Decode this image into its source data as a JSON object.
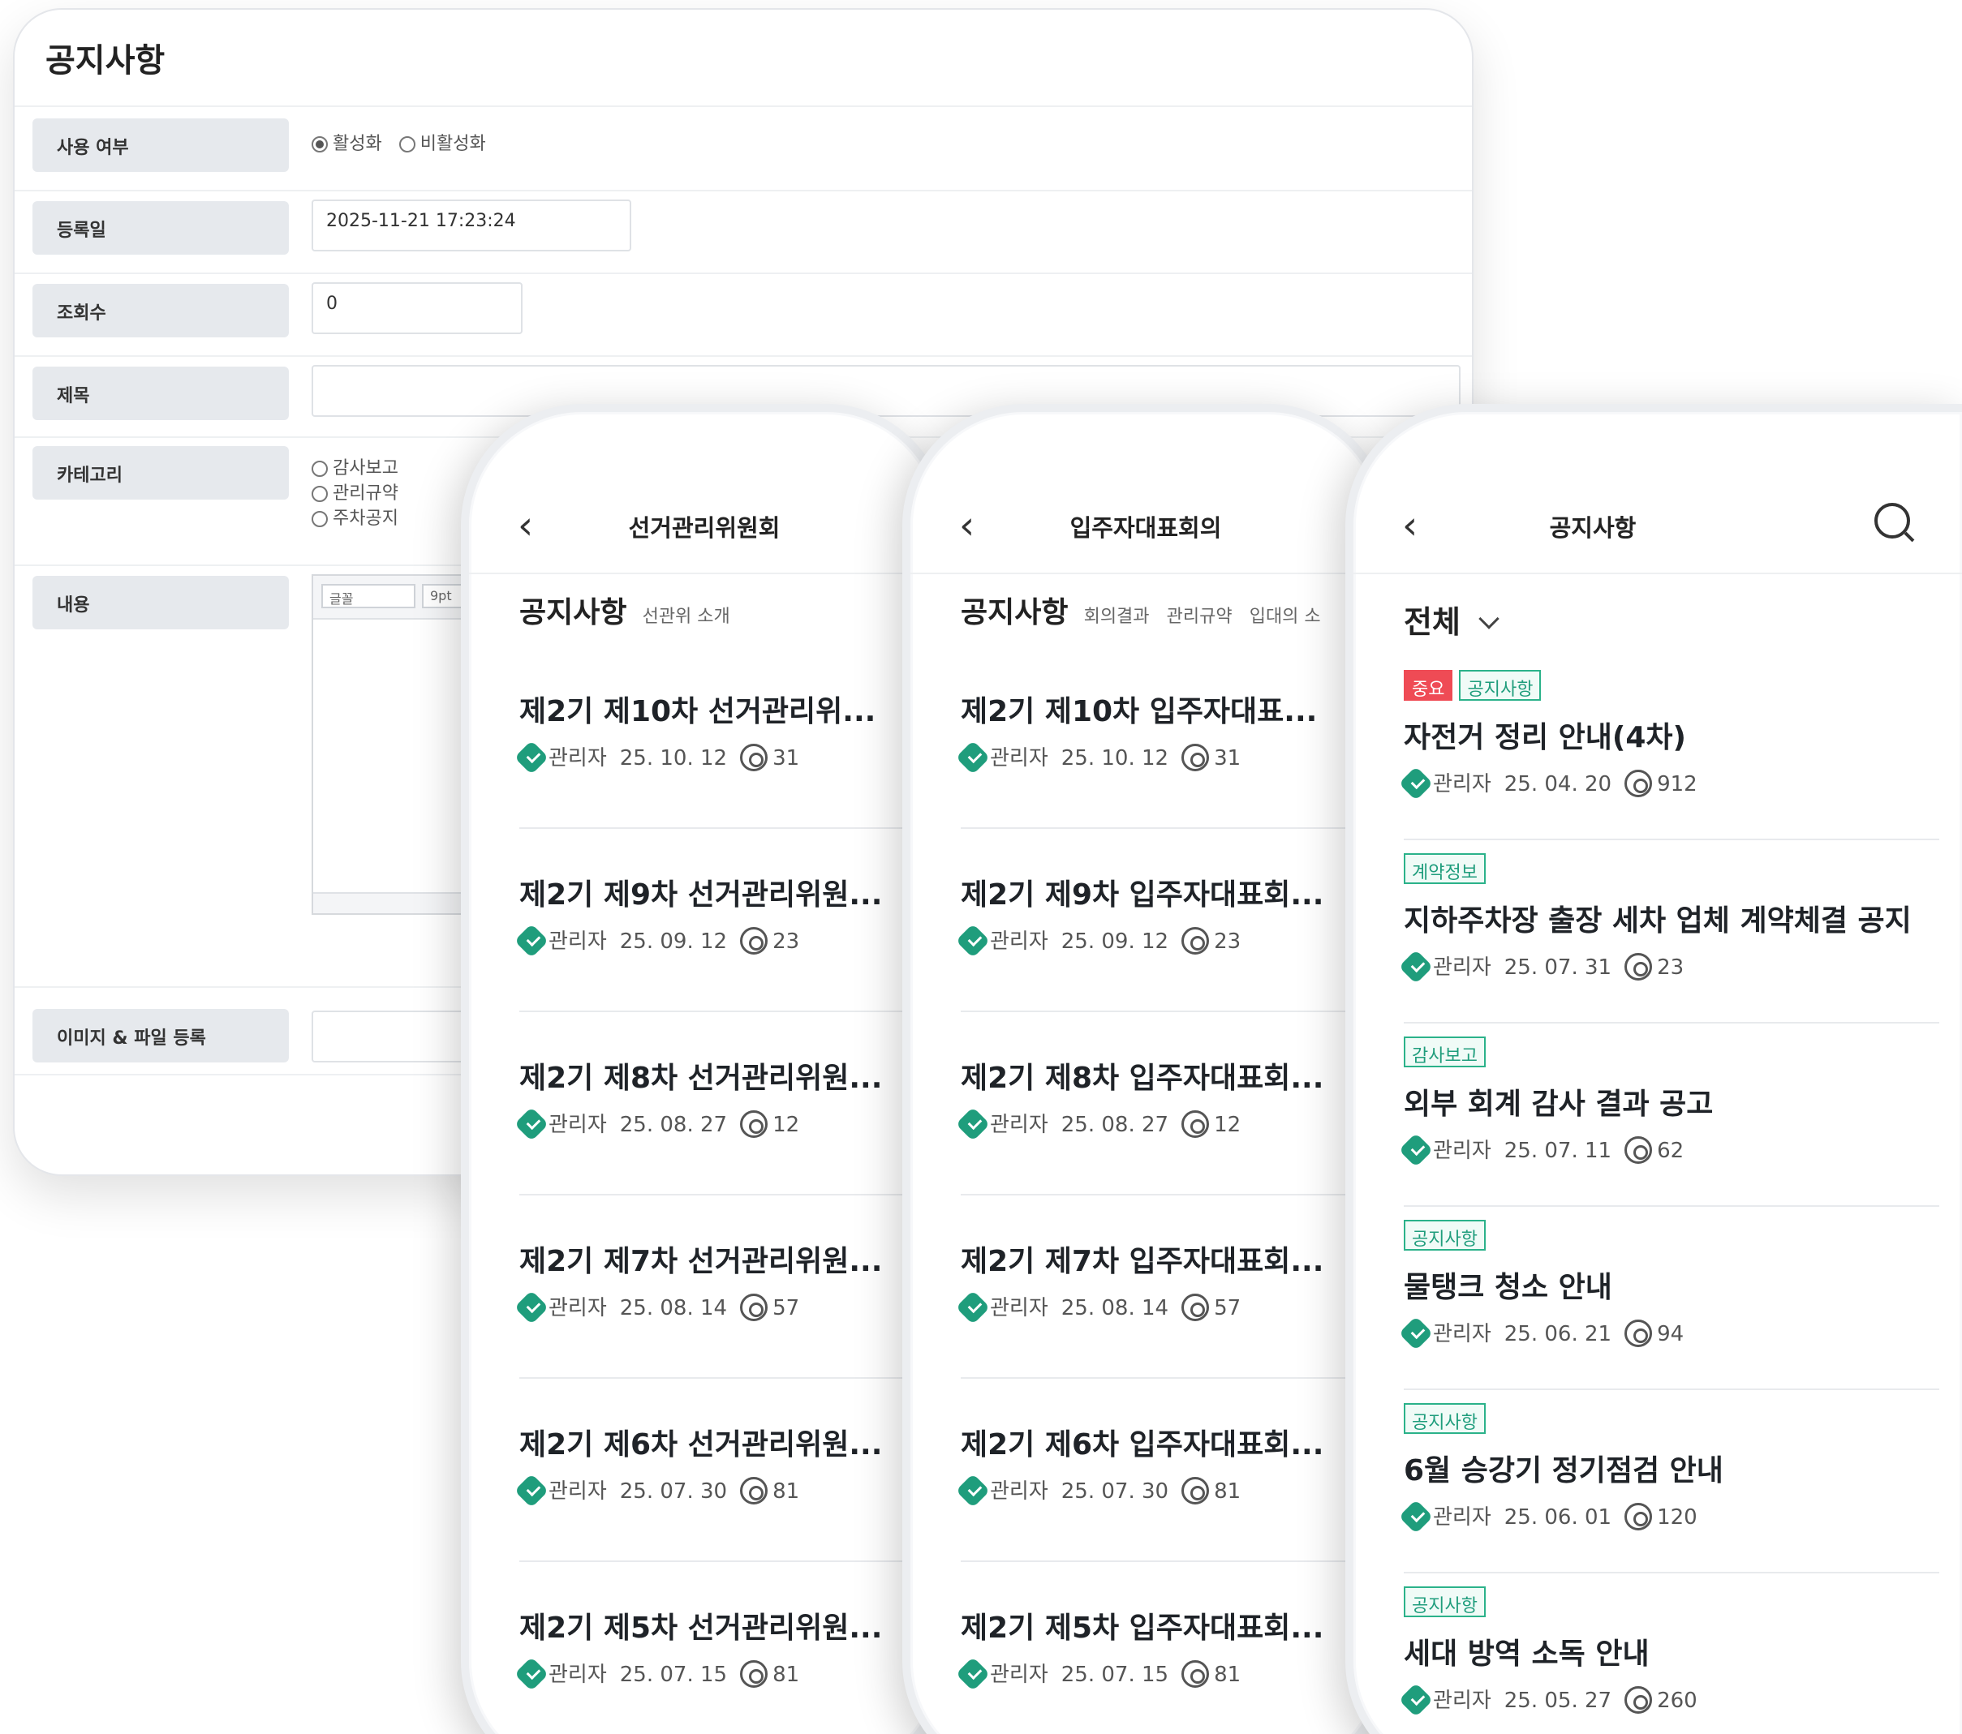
{
  "admin": {
    "title": "공지사항",
    "fields": {
      "usage": {
        "label": "사용 여부",
        "options": [
          "활성화",
          "비활성화"
        ],
        "selected": "활성화"
      },
      "reg_date": {
        "label": "등록일",
        "value": "2025-11-21 17:23:24"
      },
      "views": {
        "label": "조회수",
        "value": "0"
      },
      "subject": {
        "label": "제목",
        "value": ""
      },
      "category": {
        "label": "카테고리",
        "options": [
          "감사보고",
          "관리규약",
          "주차공지"
        ]
      },
      "content": {
        "label": "내용",
        "font_select": "글꼴",
        "size_select": "9pt"
      },
      "upload": {
        "label": "이미지 & 파일 등록"
      }
    }
  },
  "phones": [
    {
      "title": "선거관리위원회",
      "tabs": [
        "공지사항",
        "선관위 소개"
      ],
      "posts": [
        {
          "title": "제2기 제10차 선거관리위...",
          "author": "관리자",
          "date": "25. 10. 12",
          "views": "31"
        },
        {
          "title": "제2기 제9차 선거관리위원...",
          "author": "관리자",
          "date": "25. 09. 12",
          "views": "23"
        },
        {
          "title": "제2기 제8차 선거관리위원...",
          "author": "관리자",
          "date": "25. 08. 27",
          "views": "12"
        },
        {
          "title": "제2기 제7차 선거관리위원...",
          "author": "관리자",
          "date": "25. 08. 14",
          "views": "57"
        },
        {
          "title": "제2기 제6차 선거관리위원...",
          "author": "관리자",
          "date": "25. 07. 30",
          "views": "81"
        },
        {
          "title": "제2기 제5차 선거관리위원...",
          "author": "관리자",
          "date": "25. 07. 15",
          "views": "81"
        }
      ]
    },
    {
      "title": "입주자대표회의",
      "tabs": [
        "공지사항",
        "회의결과",
        "관리규약",
        "입대의 소"
      ],
      "posts": [
        {
          "title": "제2기 제10차 입주자대표...",
          "author": "관리자",
          "date": "25. 10. 12",
          "views": "31"
        },
        {
          "title": "제2기 제9차 입주자대표회...",
          "author": "관리자",
          "date": "25. 09. 12",
          "views": "23"
        },
        {
          "title": "제2기 제8차 입주자대표회...",
          "author": "관리자",
          "date": "25. 08. 27",
          "views": "12"
        },
        {
          "title": "제2기 제7차 입주자대표회...",
          "author": "관리자",
          "date": "25. 08. 14",
          "views": "57"
        },
        {
          "title": "제2기 제6차 입주자대표회...",
          "author": "관리자",
          "date": "25. 07. 30",
          "views": "81"
        },
        {
          "title": "제2기 제5차 입주자대표회...",
          "author": "관리자",
          "date": "25. 07. 15",
          "views": "81"
        }
      ]
    },
    {
      "title": "공지사항",
      "filter": "전체",
      "posts": [
        {
          "tags": [
            "중요",
            "공지사항"
          ],
          "title": "자전거 정리 안내(4차)",
          "author": "관리자",
          "date": "25. 04. 20",
          "views": "912"
        },
        {
          "tags": [
            "계약정보"
          ],
          "title": "지하주차장 출장 세차 업체 계약체결 공지",
          "author": "관리자",
          "date": "25. 07. 31",
          "views": "23"
        },
        {
          "tags": [
            "감사보고"
          ],
          "title": "외부 회계 감사 결과 공고",
          "author": "관리자",
          "date": "25. 07. 11",
          "views": "62"
        },
        {
          "tags": [
            "공지사항"
          ],
          "title": "물탱크 청소 안내",
          "author": "관리자",
          "date": "25. 06. 21",
          "views": "94"
        },
        {
          "tags": [
            "공지사항"
          ],
          "title": "6월 승강기 정기점검 안내",
          "author": "관리자",
          "date": "25. 06. 01",
          "views": "120"
        },
        {
          "tags": [
            "공지사항"
          ],
          "title": "세대 방역 소독 안내",
          "author": "관리자",
          "date": "25. 05. 27",
          "views": "260"
        }
      ]
    }
  ],
  "colors": {
    "accent_green": "#1f9d7c",
    "important_red": "#ef4b55"
  }
}
